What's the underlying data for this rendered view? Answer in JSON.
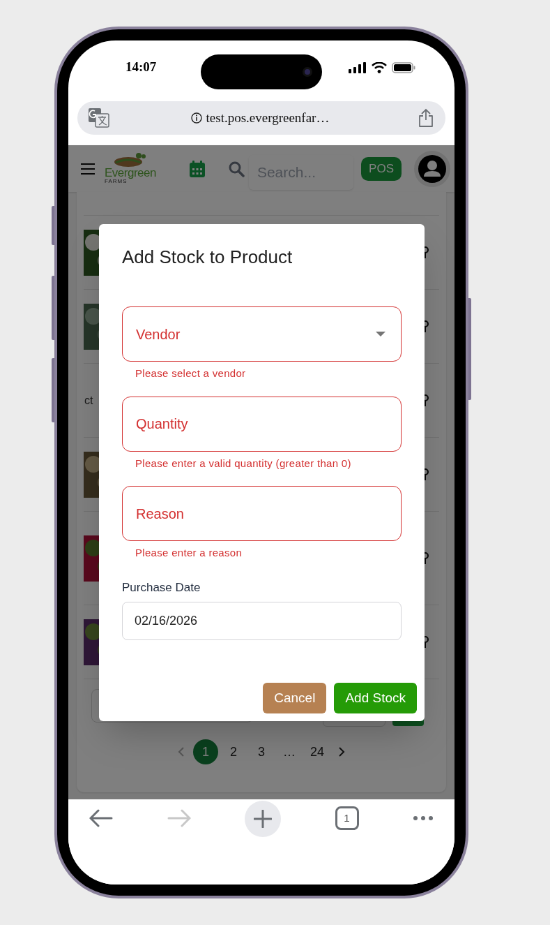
{
  "status_bar": {
    "time": "14:07"
  },
  "browser": {
    "url": "test.pos.evergreenfar…",
    "tab_count": "1"
  },
  "header": {
    "logo": {
      "name": "Evergreen",
      "tagline": "FARMS"
    },
    "search": {
      "placeholder": "Search..."
    },
    "pos_button": "POS"
  },
  "list": {
    "rows": [
      {
        "kind": "picture"
      },
      {
        "kind": "picture"
      },
      {
        "kind": "text",
        "text": "ct"
      },
      {
        "kind": "picture"
      },
      {
        "kind": "picture"
      },
      {
        "kind": "picture"
      }
    ]
  },
  "pagination": {
    "pages": [
      {
        "label": "1",
        "selected": true
      },
      {
        "label": "2",
        "selected": false
      },
      {
        "label": "3",
        "selected": false
      },
      {
        "label": "…",
        "selected": false
      },
      {
        "label": "24",
        "selected": false
      }
    ]
  },
  "dialog": {
    "title": "Add Stock to Product",
    "fields": [
      {
        "kind": "select",
        "label": "Vendor",
        "error": "Please select a vendor"
      },
      {
        "kind": "text",
        "label": "Quantity",
        "error": "Please enter a valid quantity (greater than 0)"
      },
      {
        "kind": "text",
        "label": "Reason",
        "error": "Please enter a reason"
      },
      {
        "kind": "date",
        "label": "Purchase Date",
        "value": "02/16/2026"
      }
    ],
    "buttons": [
      {
        "kind": "secondary",
        "label": "Cancel"
      },
      {
        "kind": "primary",
        "label": "Add Stock"
      }
    ]
  }
}
